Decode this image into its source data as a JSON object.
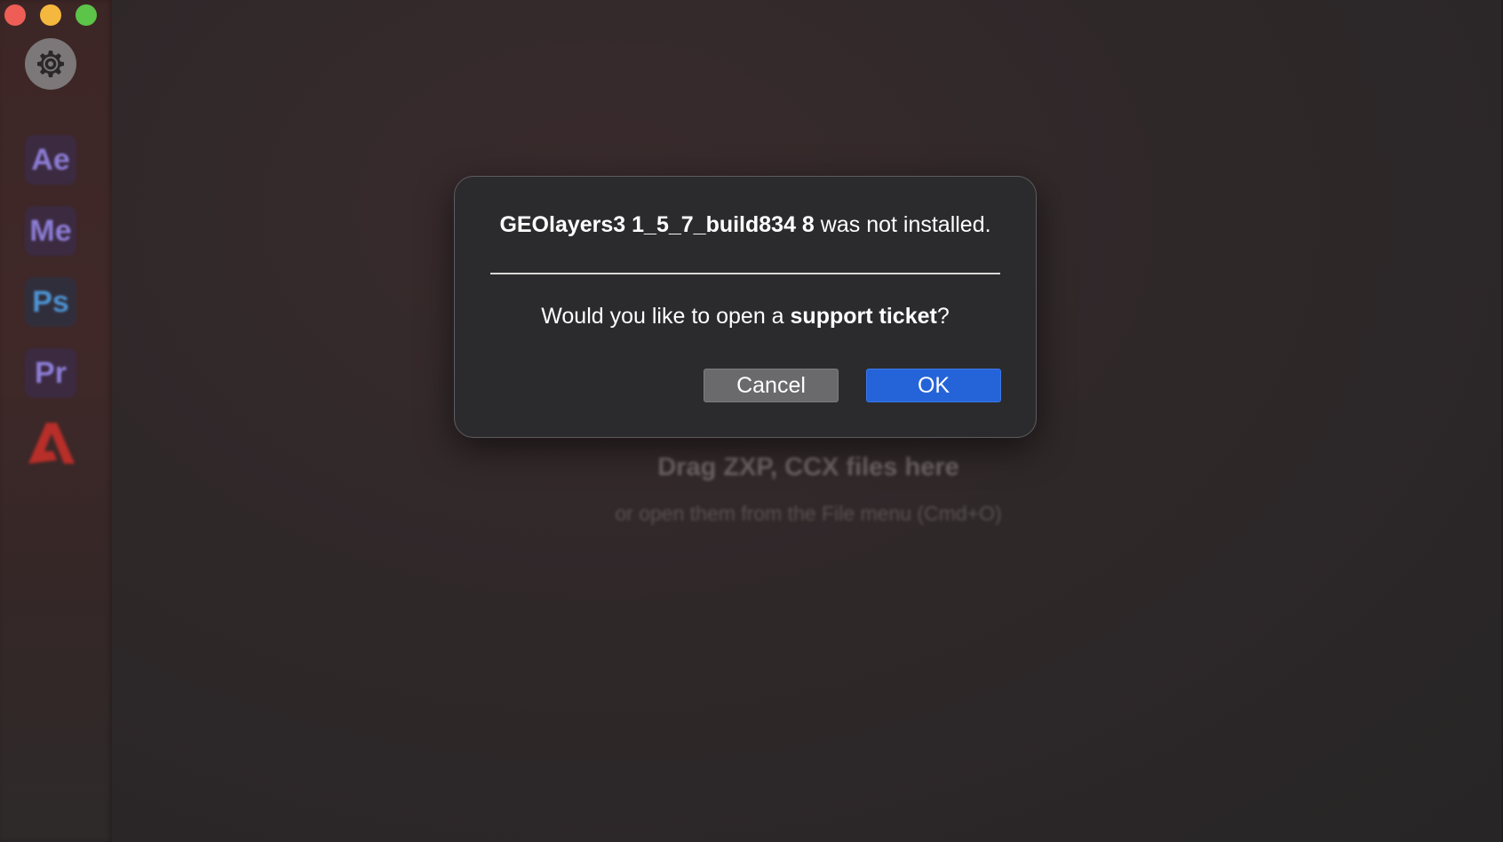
{
  "window": {
    "controls": [
      "close",
      "minimize",
      "maximize"
    ]
  },
  "sidebar": {
    "settings_icon": "gear-icon",
    "apps": [
      {
        "label": "Ae",
        "color": "#9a8cf5",
        "bg": "#3b2b45"
      },
      {
        "label": "Me",
        "color": "#9a8cf5",
        "bg": "#3b2b45"
      },
      {
        "label": "Ps",
        "color": "#4fa6f0",
        "bg": "#2f3040"
      },
      {
        "label": "Pr",
        "color": "#9a8cf5",
        "bg": "#3b2b45"
      }
    ],
    "adobe_logo_color": "#d8302a"
  },
  "dropzone": {
    "title": "Drag ZXP, CCX files here",
    "subtitle": "or open them from the File menu (Cmd+O)"
  },
  "dialog": {
    "title_bold": "GEOlayers3 1_5_7_build834 8",
    "title_rest": " was not installed.",
    "question_prefix": "Would you like to open a ",
    "question_bold": "support ticket",
    "question_suffix": "?",
    "cancel_label": "Cancel",
    "ok_label": "OK",
    "ok_color": "#2563d9"
  }
}
